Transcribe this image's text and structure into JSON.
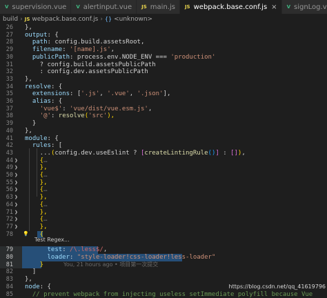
{
  "tabs": [
    {
      "label": "supervision.vue",
      "type": "vue",
      "active": false
    },
    {
      "label": "alertinput.vue",
      "type": "vue",
      "active": false
    },
    {
      "label": "main.js",
      "type": "js",
      "active": false
    },
    {
      "label": "webpack.base.conf.js",
      "type": "js",
      "active": true
    },
    {
      "label": "signLog.vue",
      "type": "vue",
      "active": false
    }
  ],
  "breadcrumb": {
    "folder": "build",
    "file_icon": "JS",
    "file": "webpack.base.conf.js",
    "symbol_icon": "{}",
    "symbol": "<unknown>"
  },
  "file_type_icons": {
    "vue": "V",
    "js": "JS"
  },
  "hover": {
    "label": "Test Regex..."
  },
  "blame": {
    "text": "You, 21 hours ago • 项目第一次提交"
  },
  "watermark": {
    "text": "https://blog.csdn.net/qq_41619796"
  },
  "lines": [
    {
      "n": "26",
      "fold": "",
      "tokens": [
        [
          "},",
          "p"
        ]
      ]
    },
    {
      "n": "27",
      "fold": "",
      "tokens": [
        [
          "output",
          "k"
        ],
        [
          ": {",
          "p"
        ]
      ]
    },
    {
      "n": "28",
      "fold": "",
      "tokens": [
        [
          "  path",
          "k"
        ],
        [
          ": config.build.assetsRoot,",
          "p"
        ]
      ]
    },
    {
      "n": "29",
      "fold": "",
      "tokens": [
        [
          "  filename",
          "k"
        ],
        [
          ": ",
          "p"
        ],
        [
          "'[name].js'",
          "s"
        ],
        [
          ",",
          "p"
        ]
      ]
    },
    {
      "n": "30",
      "fold": "",
      "tokens": [
        [
          "  publicPath",
          "k"
        ],
        [
          ": process.env.NODE_ENV === ",
          "p"
        ],
        [
          "'production'",
          "s"
        ]
      ]
    },
    {
      "n": "31",
      "fold": "",
      "tokens": [
        [
          "    ? config.build.assetsPublicPath",
          "p"
        ]
      ]
    },
    {
      "n": "32",
      "fold": "",
      "tokens": [
        [
          "    : config.dev.assetsPublicPath",
          "p"
        ]
      ]
    },
    {
      "n": "33",
      "fold": "",
      "tokens": [
        [
          "},",
          "p"
        ]
      ]
    },
    {
      "n": "34",
      "fold": "",
      "tokens": [
        [
          "resolve",
          "k"
        ],
        [
          ": {",
          "p"
        ]
      ]
    },
    {
      "n": "35",
      "fold": "",
      "tokens": [
        [
          "  extensions",
          "k"
        ],
        [
          ": [",
          "p"
        ],
        [
          "'.js'",
          "s"
        ],
        [
          ", ",
          "p"
        ],
        [
          "'.vue'",
          "s"
        ],
        [
          ", ",
          "p"
        ],
        [
          "'.json'",
          "s"
        ],
        [
          "],",
          "p"
        ]
      ]
    },
    {
      "n": "36",
      "fold": "",
      "tokens": [
        [
          "  alias",
          "k"
        ],
        [
          ": {",
          "p"
        ]
      ]
    },
    {
      "n": "37",
      "fold": "",
      "tokens": [
        [
          "    ",
          "p"
        ],
        [
          "'vue$'",
          "s"
        ],
        [
          ": ",
          "p"
        ],
        [
          "'vue/dist/vue.esm.js'",
          "s"
        ],
        [
          ",",
          "p"
        ]
      ]
    },
    {
      "n": "38",
      "fold": "",
      "tokens": [
        [
          "    ",
          "p"
        ],
        [
          "'@'",
          "s"
        ],
        [
          ": ",
          "p"
        ],
        [
          "resolve",
          "f"
        ],
        [
          "(",
          "b1"
        ],
        [
          "'src'",
          "s"
        ],
        [
          "),",
          "b1"
        ]
      ]
    },
    {
      "n": "39",
      "fold": "",
      "tokens": [
        [
          "  }",
          "p"
        ]
      ]
    },
    {
      "n": "40",
      "fold": "",
      "tokens": [
        [
          "},",
          "p"
        ]
      ]
    },
    {
      "n": "41",
      "fold": "",
      "tokens": [
        [
          "module",
          "k"
        ],
        [
          ": {",
          "p"
        ]
      ]
    },
    {
      "n": "42",
      "fold": "",
      "tokens": [
        [
          "  rules",
          "k"
        ],
        [
          ": [",
          "p"
        ]
      ]
    },
    {
      "n": "43",
      "fold": "",
      "tokens": [
        [
          "    ...",
          "p"
        ],
        [
          "(",
          "b1"
        ],
        [
          "config.dev.useEslint ? ",
          "p"
        ],
        [
          "[",
          "b2"
        ],
        [
          "createLintingRule",
          "f"
        ],
        [
          "()",
          "b3"
        ],
        [
          "]",
          "b2"
        ],
        [
          " : ",
          "p"
        ],
        [
          "[]",
          "b2"
        ],
        [
          ")",
          "b1"
        ],
        [
          ",",
          "p"
        ]
      ]
    },
    {
      "n": "44",
      "fold": ">",
      "tokens": [
        [
          "    {",
          "b1"
        ],
        [
          "…",
          "gl"
        ]
      ]
    },
    {
      "n": "49",
      "fold": ">",
      "tokens": [
        [
          "    },",
          "b1"
        ]
      ]
    },
    {
      "n": "50",
      "fold": ">",
      "tokens": [
        [
          "    {",
          "b1"
        ],
        [
          "…",
          "gl"
        ]
      ]
    },
    {
      "n": "55",
      "fold": ">",
      "tokens": [
        [
          "    },",
          "b1"
        ]
      ]
    },
    {
      "n": "56",
      "fold": ">",
      "tokens": [
        [
          "    {",
          "b1"
        ],
        [
          "…",
          "gl"
        ]
      ]
    },
    {
      "n": "63",
      "fold": ">",
      "tokens": [
        [
          "    },",
          "b1"
        ]
      ]
    },
    {
      "n": "64",
      "fold": ">",
      "tokens": [
        [
          "    {",
          "b1"
        ],
        [
          "…",
          "gl"
        ]
      ]
    },
    {
      "n": "71",
      "fold": ">",
      "tokens": [
        [
          "    },",
          "b1"
        ]
      ]
    },
    {
      "n": "72",
      "fold": ">",
      "tokens": [
        [
          "    {",
          "b1"
        ],
        [
          "…",
          "gl"
        ]
      ]
    },
    {
      "n": "77",
      "fold": ">",
      "tokens": [
        [
          "    },",
          "b1"
        ]
      ]
    },
    {
      "n": "78",
      "fold": "",
      "tokens": [
        [
          "    {",
          "b1"
        ]
      ]
    },
    {
      "n": "",
      "fold": "",
      "tokens": []
    },
    {
      "n": "79",
      "fold": "",
      "tokens": [
        [
          "      test",
          "k"
        ],
        [
          ": ",
          "p"
        ],
        [
          "/\\.less$/",
          "r"
        ],
        [
          ",",
          "p"
        ]
      ]
    },
    {
      "n": "80",
      "fold": "",
      "tokens": [
        [
          "      loader",
          "k"
        ],
        [
          ": ",
          "p"
        ],
        [
          "\"style-loader!css-loader!less-loader\"",
          "s"
        ]
      ]
    },
    {
      "n": "81",
      "fold": "",
      "tokens": [
        [
          "    }",
          "b1"
        ]
      ]
    },
    {
      "n": "82",
      "fold": "",
      "tokens": [
        [
          "  ]",
          "p"
        ]
      ]
    },
    {
      "n": "83",
      "fold": "",
      "tokens": [
        [
          "},",
          "p"
        ]
      ]
    },
    {
      "n": "84",
      "fold": "",
      "tokens": [
        [
          "node",
          "k"
        ],
        [
          ": {",
          "p"
        ]
      ]
    },
    {
      "n": "85",
      "fold": "",
      "tokens": [
        [
          "  // prevent webpack from injecting useless setImmediate polyfill because Vue",
          "c"
        ]
      ]
    }
  ]
}
